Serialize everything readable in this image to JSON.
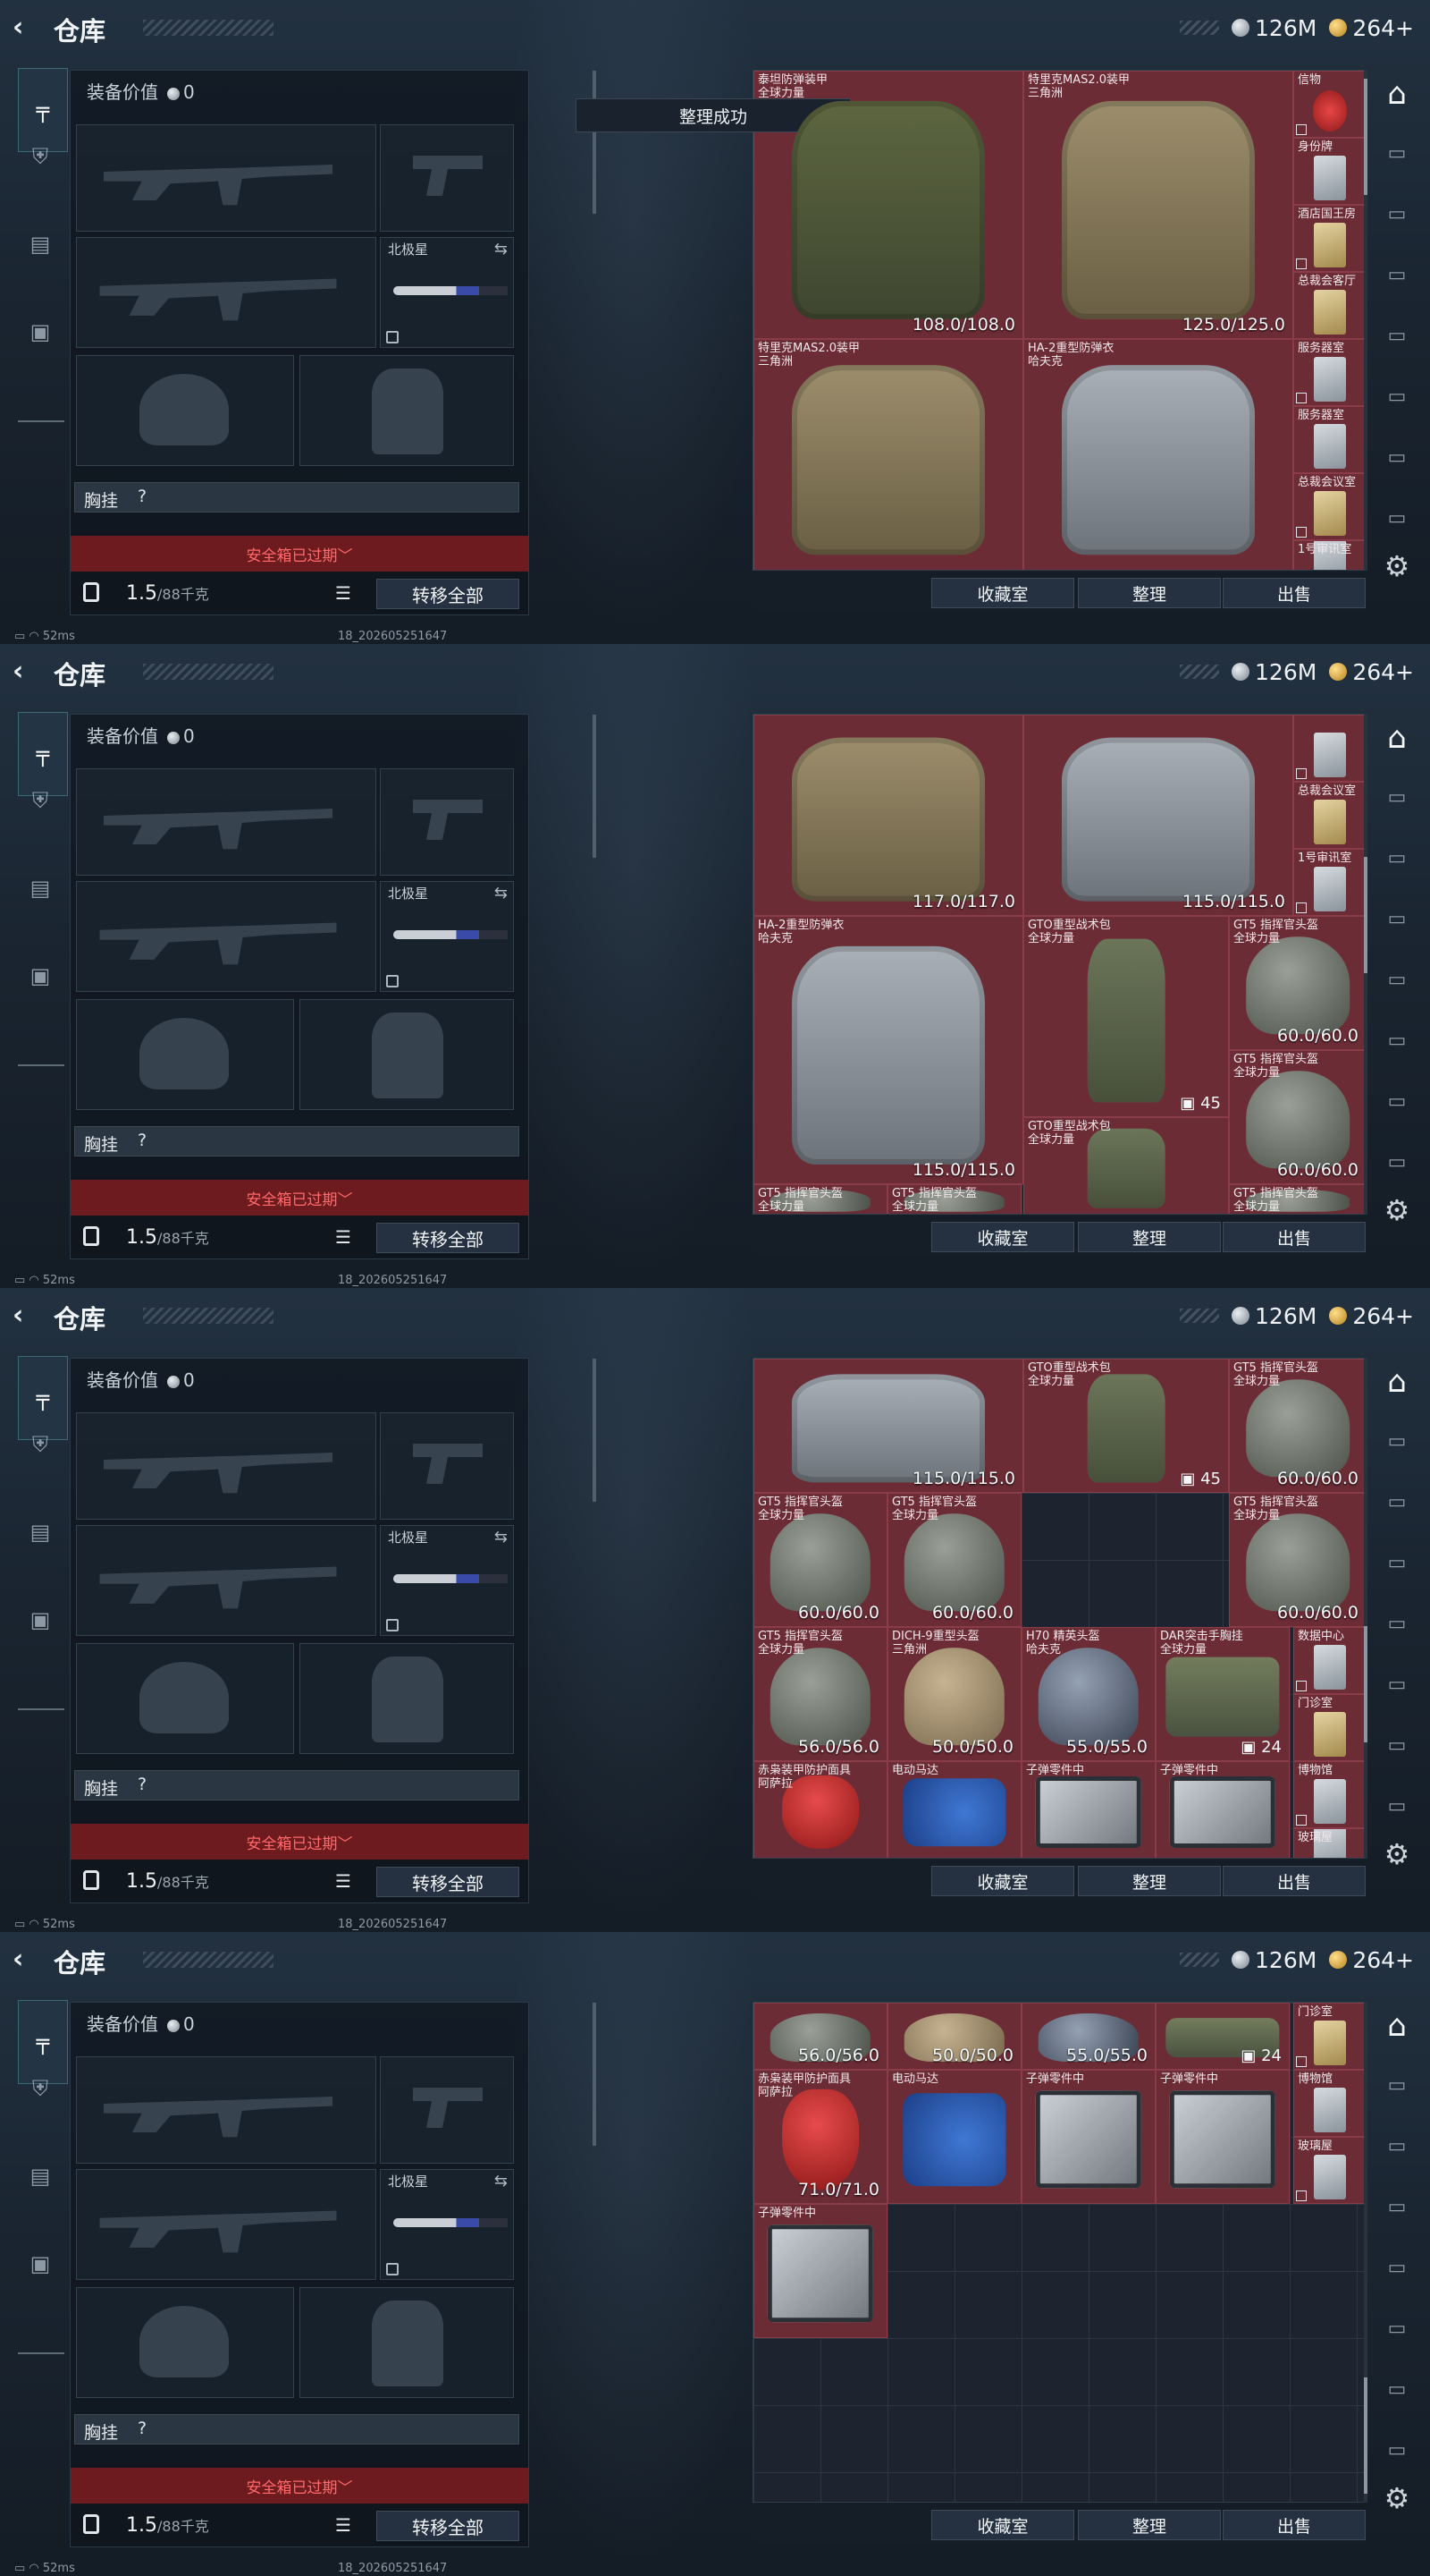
{
  "page": {
    "title": "仓库",
    "silver": "126M",
    "gold": "264+"
  },
  "equip": {
    "value_label": "装备价值",
    "value": "0",
    "melee_label": "北极星",
    "chest_label": "胸挂",
    "chest_hint": "?",
    "safe_label": "安全箱已过期",
    "weight": "1.5",
    "weight_cap": "/88千克",
    "transfer_label": "转移全部"
  },
  "toast": "整理成功",
  "buttons": {
    "collection": "收藏室",
    "sort": "整理",
    "sell": "出售"
  },
  "footer": {
    "ping": "52ms",
    "version": "18_202605251647"
  },
  "colors": {
    "item_bg": "#6c2c36",
    "safe_bg": "#6e1b1f",
    "safe_text": "#ff6a6a"
  },
  "panels": [
    {
      "items": [
        {
          "name": "泰坦防弹装甲\n全球力量",
          "dur": "108.0/108.0",
          "art": "vest green"
        },
        {
          "name": "特里克MAS2.0装甲\n三角洲",
          "dur": "125.0/125.0",
          "art": "vest tan"
        },
        {
          "name": "信物",
          "art": "card r"
        },
        {
          "name": "身份牌",
          "art": "card"
        },
        {
          "name": "酒店国王房",
          "art": "card g"
        },
        {
          "name": "总裁会客厅",
          "art": "card g"
        },
        {
          "name": "特里克MAS2.0装甲\n三角洲",
          "art": "vest tan"
        },
        {
          "name": "HA-2重型防弹衣\n哈夫克",
          "art": "vest grey"
        },
        {
          "name": "服务器室",
          "art": "card"
        },
        {
          "name": "服务器室",
          "art": "card"
        },
        {
          "name": "总裁会议室",
          "art": "card g"
        },
        {
          "name": "1号审讯室",
          "art": "card"
        }
      ]
    },
    {
      "items": [
        {
          "name": "",
          "dur": "117.0/117.0",
          "art": "vest tan"
        },
        {
          "name": "",
          "dur": "115.0/115.0",
          "art": "vest grey"
        },
        {
          "name": "",
          "art": "card"
        },
        {
          "name": "总裁会议室",
          "art": "card g"
        },
        {
          "name": "1号审讯室",
          "art": "card"
        },
        {
          "name": "HA-2重型防弹衣\n哈夫克",
          "dur": "115.0/115.0",
          "art": "vest grey"
        },
        {
          "name": "GTO重型战术包\n全球力量",
          "count": "45",
          "art": "vest olive"
        },
        {
          "name": "GT5 指挥官头盔\n全球力量",
          "dur": "60.0/60.0",
          "art": "helm"
        },
        {
          "name": "GT5 指挥官头盔\n全球力量",
          "dur": "60.0/60.0",
          "art": "helm"
        },
        {
          "name": "GTO重型战术包\n全球力量",
          "art": "vest olive"
        },
        {
          "name": "GT5 指挥官头盔\n全球力量",
          "art": "helm"
        },
        {
          "name": "GT5 指挥官头盔\n全球力量",
          "art": "helm"
        },
        {
          "name": "GT5 指挥官头盔\n全球力量",
          "art": "helm"
        }
      ]
    },
    {
      "items": [
        {
          "name": "",
          "dur": "115.0/115.0",
          "art": "vest grey"
        },
        {
          "name": "GTO重型战术包\n全球力量",
          "count": "45",
          "art": "vest olive"
        },
        {
          "name": "GT5 指挥官头盔\n全球力量",
          "dur": "60.0/60.0",
          "art": "helm"
        },
        {
          "name": "GT5 指挥官头盔\n全球力量",
          "dur": "60.0/60.0",
          "art": "helm"
        },
        {
          "name": "GT5 指挥官头盔\n全球力量",
          "dur": "60.0/60.0",
          "art": "helm"
        },
        {
          "name": "GT5 指挥官头盔\n全球力量",
          "dur": "60.0/60.0",
          "art": "helm"
        },
        {
          "name": "GT5 指挥官头盔\n全球力量",
          "dur": "56.0/56.0",
          "art": "helm"
        },
        {
          "name": "DICH-9重型头盔\n三角洲",
          "dur": "50.0/50.0",
          "art": "helm tan"
        },
        {
          "name": "H70 精英头盔\n哈夫克",
          "dur": "55.0/55.0",
          "art": "helm dark"
        },
        {
          "name": "DAR突击手胸挂\n全球力量",
          "count": "24",
          "art": "bag"
        },
        {
          "name": "数据中心",
          "art": "card"
        },
        {
          "name": "门诊室",
          "art": "card g"
        },
        {
          "name": "赤枭装甲防护面具\n阿萨拉",
          "art": "mask"
        },
        {
          "name": "电动马达",
          "art": "motor"
        },
        {
          "name": "子弹零件中",
          "art": "parts"
        },
        {
          "name": "子弹零件中",
          "art": "parts"
        },
        {
          "name": "博物馆",
          "art": "card"
        },
        {
          "name": "玻璃屋",
          "art": "card"
        }
      ]
    },
    {
      "items": [
        {
          "name": "",
          "dur": "56.0/56.0",
          "art": "helm"
        },
        {
          "name": "",
          "dur": "50.0/50.0",
          "art": "helm tan"
        },
        {
          "name": "",
          "dur": "55.0/55.0",
          "art": "helm dark"
        },
        {
          "name": "",
          "count": "24",
          "art": "bag"
        },
        {
          "name": "门诊室",
          "art": "card g"
        },
        {
          "name": "赤枭装甲防护面具\n阿萨拉",
          "dur": "71.0/71.0",
          "art": "mask"
        },
        {
          "name": "电动马达",
          "art": "motor"
        },
        {
          "name": "子弹零件中",
          "art": "parts"
        },
        {
          "name": "子弹零件中",
          "art": "parts"
        },
        {
          "name": "博物馆",
          "art": "card"
        },
        {
          "name": "玻璃屋",
          "art": "card"
        },
        {
          "name": "子弹零件中",
          "art": "parts"
        }
      ]
    }
  ]
}
